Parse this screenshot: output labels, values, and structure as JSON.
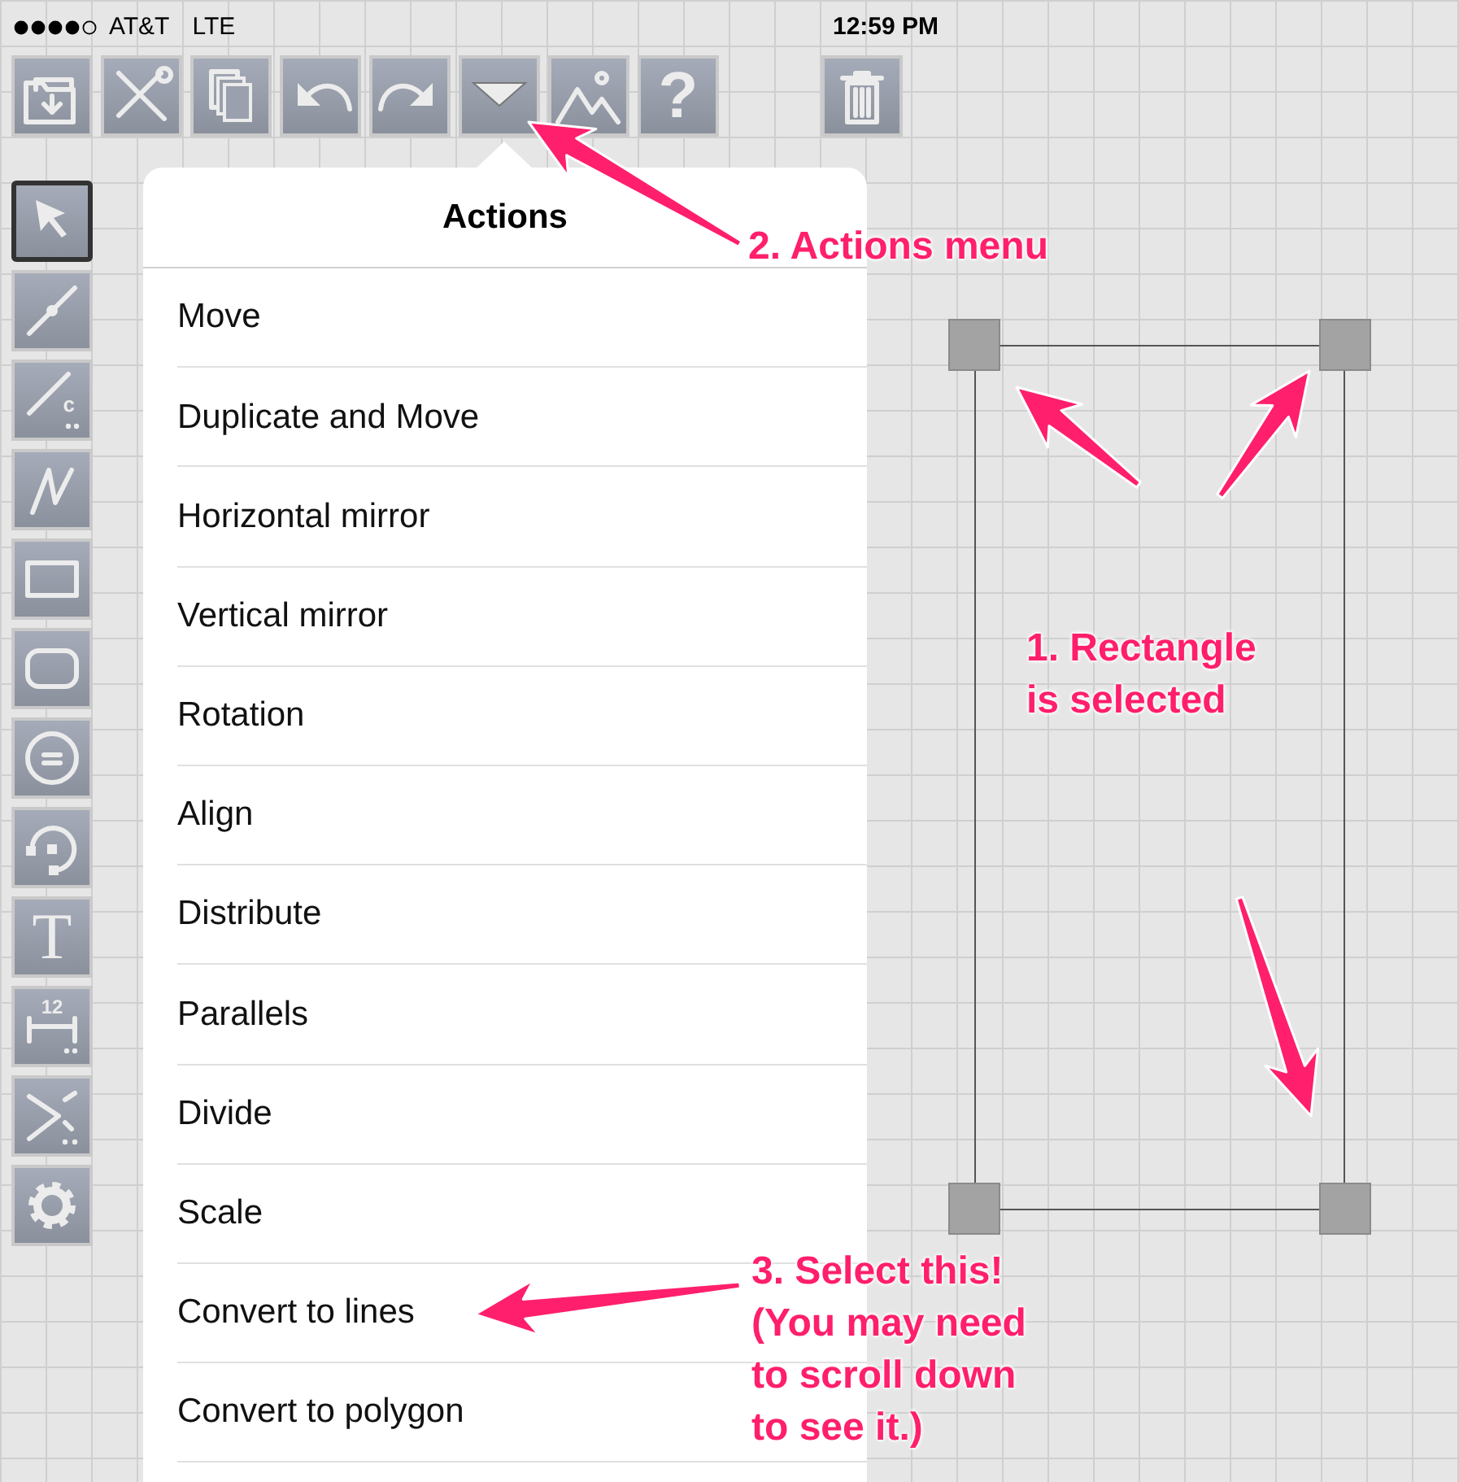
{
  "status_bar": {
    "carrier": "AT&T",
    "network": "LTE",
    "time": "12:59 PM"
  },
  "toolbar": [
    {
      "kind": "folder"
    },
    {
      "kind": "tools"
    },
    {
      "kind": "pages"
    },
    {
      "kind": "undo"
    },
    {
      "kind": "redo"
    },
    {
      "kind": "actions"
    },
    {
      "kind": "picture"
    },
    {
      "kind": "help",
      "label": "?"
    },
    {
      "kind": "trash"
    }
  ],
  "tools": [
    {
      "kind": "select",
      "selected": true
    },
    {
      "kind": "line",
      "selected": false
    },
    {
      "kind": "line_constraint",
      "label": "c",
      "selected": false
    },
    {
      "kind": "polyline",
      "selected": false
    },
    {
      "kind": "rectangle",
      "selected": false
    },
    {
      "kind": "rounded_rectangle",
      "selected": false
    },
    {
      "kind": "circle",
      "selected": false
    },
    {
      "kind": "arc",
      "selected": false
    },
    {
      "kind": "text",
      "label": "T",
      "selected": false
    },
    {
      "kind": "dimension",
      "label": "12",
      "selected": false
    },
    {
      "kind": "angle",
      "selected": false
    },
    {
      "kind": "settings",
      "selected": false
    }
  ],
  "menu": {
    "title": "Actions",
    "items": [
      "Move",
      "Duplicate and Move",
      "Horizontal mirror",
      "Vertical mirror",
      "Rotation",
      "Align",
      "Distribute",
      "Parallels",
      "Divide",
      "Scale",
      "Convert to lines",
      "Convert to polygon"
    ]
  },
  "canvas": {
    "shape": {
      "kind": "rectangle",
      "selected": true
    }
  },
  "annotations": [
    {
      "lines": [
        "2. Actions menu"
      ]
    },
    {
      "lines": [
        "1. Rectangle",
        "is selected"
      ]
    },
    {
      "lines": [
        "3. Select this!",
        "(You may need",
        "to scroll down",
        "to see it.)"
      ]
    }
  ]
}
